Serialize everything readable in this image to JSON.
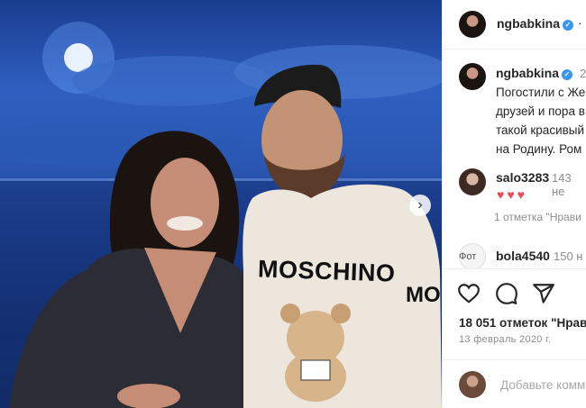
{
  "post": {
    "author": "ngbabkina",
    "time": "2",
    "caption_lines": [
      "Погостили с Же",
      "друзей и пора в",
      "такой красивый",
      "на Родину. Ром"
    ],
    "shirt_text": "MOSCHINO",
    "shirt_text_side": "MO"
  },
  "comments": [
    {
      "user": "salo3283",
      "time": "143 не",
      "hearts": "♥♥♥",
      "likes": "1 отметка \"Нрави"
    },
    {
      "user": "bola4540",
      "time": "150 н",
      "badge": "Фот"
    }
  ],
  "footer": {
    "likes": "18 051 отметок \"Нрав",
    "date": "13 февраль 2020 г.",
    "comment_placeholder": "Добавьте комм"
  },
  "colors": {
    "verified": "#3897f0",
    "heart": "#ed4956"
  },
  "icons": [
    "verified-icon",
    "heart-icon",
    "comment-icon",
    "share-icon",
    "next-photo-icon"
  ]
}
